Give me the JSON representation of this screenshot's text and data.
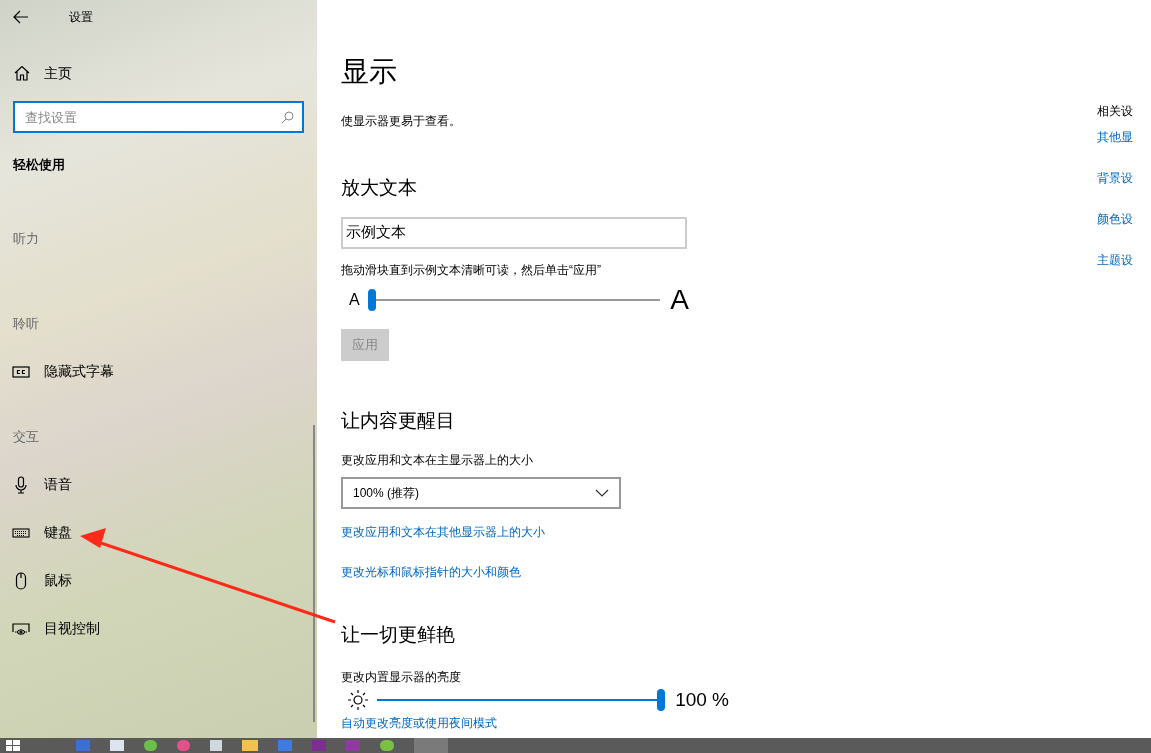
{
  "sidebar": {
    "title": "设置",
    "home": "主页",
    "search": {
      "placeholder": "查找设置"
    },
    "category": "轻松使用",
    "groups": [
      {
        "heading": "听力"
      },
      {
        "heading": "聆听",
        "items": [
          {
            "kind": "captions",
            "label": "隐藏式字幕",
            "selected": false
          }
        ]
      },
      {
        "heading": "交互",
        "items": [
          {
            "kind": "speech",
            "label": "语音",
            "selected": false
          },
          {
            "kind": "keyboard",
            "label": "键盘",
            "selected": false
          },
          {
            "kind": "mouse",
            "label": "鼠标",
            "selected": false
          },
          {
            "kind": "eye",
            "label": "目视控制",
            "selected": false
          }
        ]
      }
    ]
  },
  "main": {
    "title": "显示",
    "subtitle": "使显示器更易于查看。",
    "enlarge": {
      "heading": "放大文本",
      "sample": "示例文本",
      "hint": "拖动滑块直到示例文本清晰可读，然后单击“应用”",
      "small_a": "A",
      "large_a": "A",
      "level": 0.0,
      "apply": {
        "label": "应用",
        "disabled": true
      }
    },
    "stand_out": {
      "heading": "让内容更醒目",
      "label": "更改应用和文本在主显示器上的大小",
      "dropdown": "100% (推荐)",
      "links": [
        "更改应用和文本在其他显示器上的大小",
        "更改光标和鼠标指针的大小和颜色"
      ]
    },
    "brighter": {
      "heading": "让一切更鲜艳",
      "label": "更改内置显示器的亮度",
      "level": 1.0,
      "reading": "100 %",
      "link": "自动更改亮度或使用夜间模式"
    }
  },
  "related": {
    "heading": "相关设",
    "links": [
      "其他显",
      "背景设",
      "颜色设",
      "主题设"
    ]
  }
}
